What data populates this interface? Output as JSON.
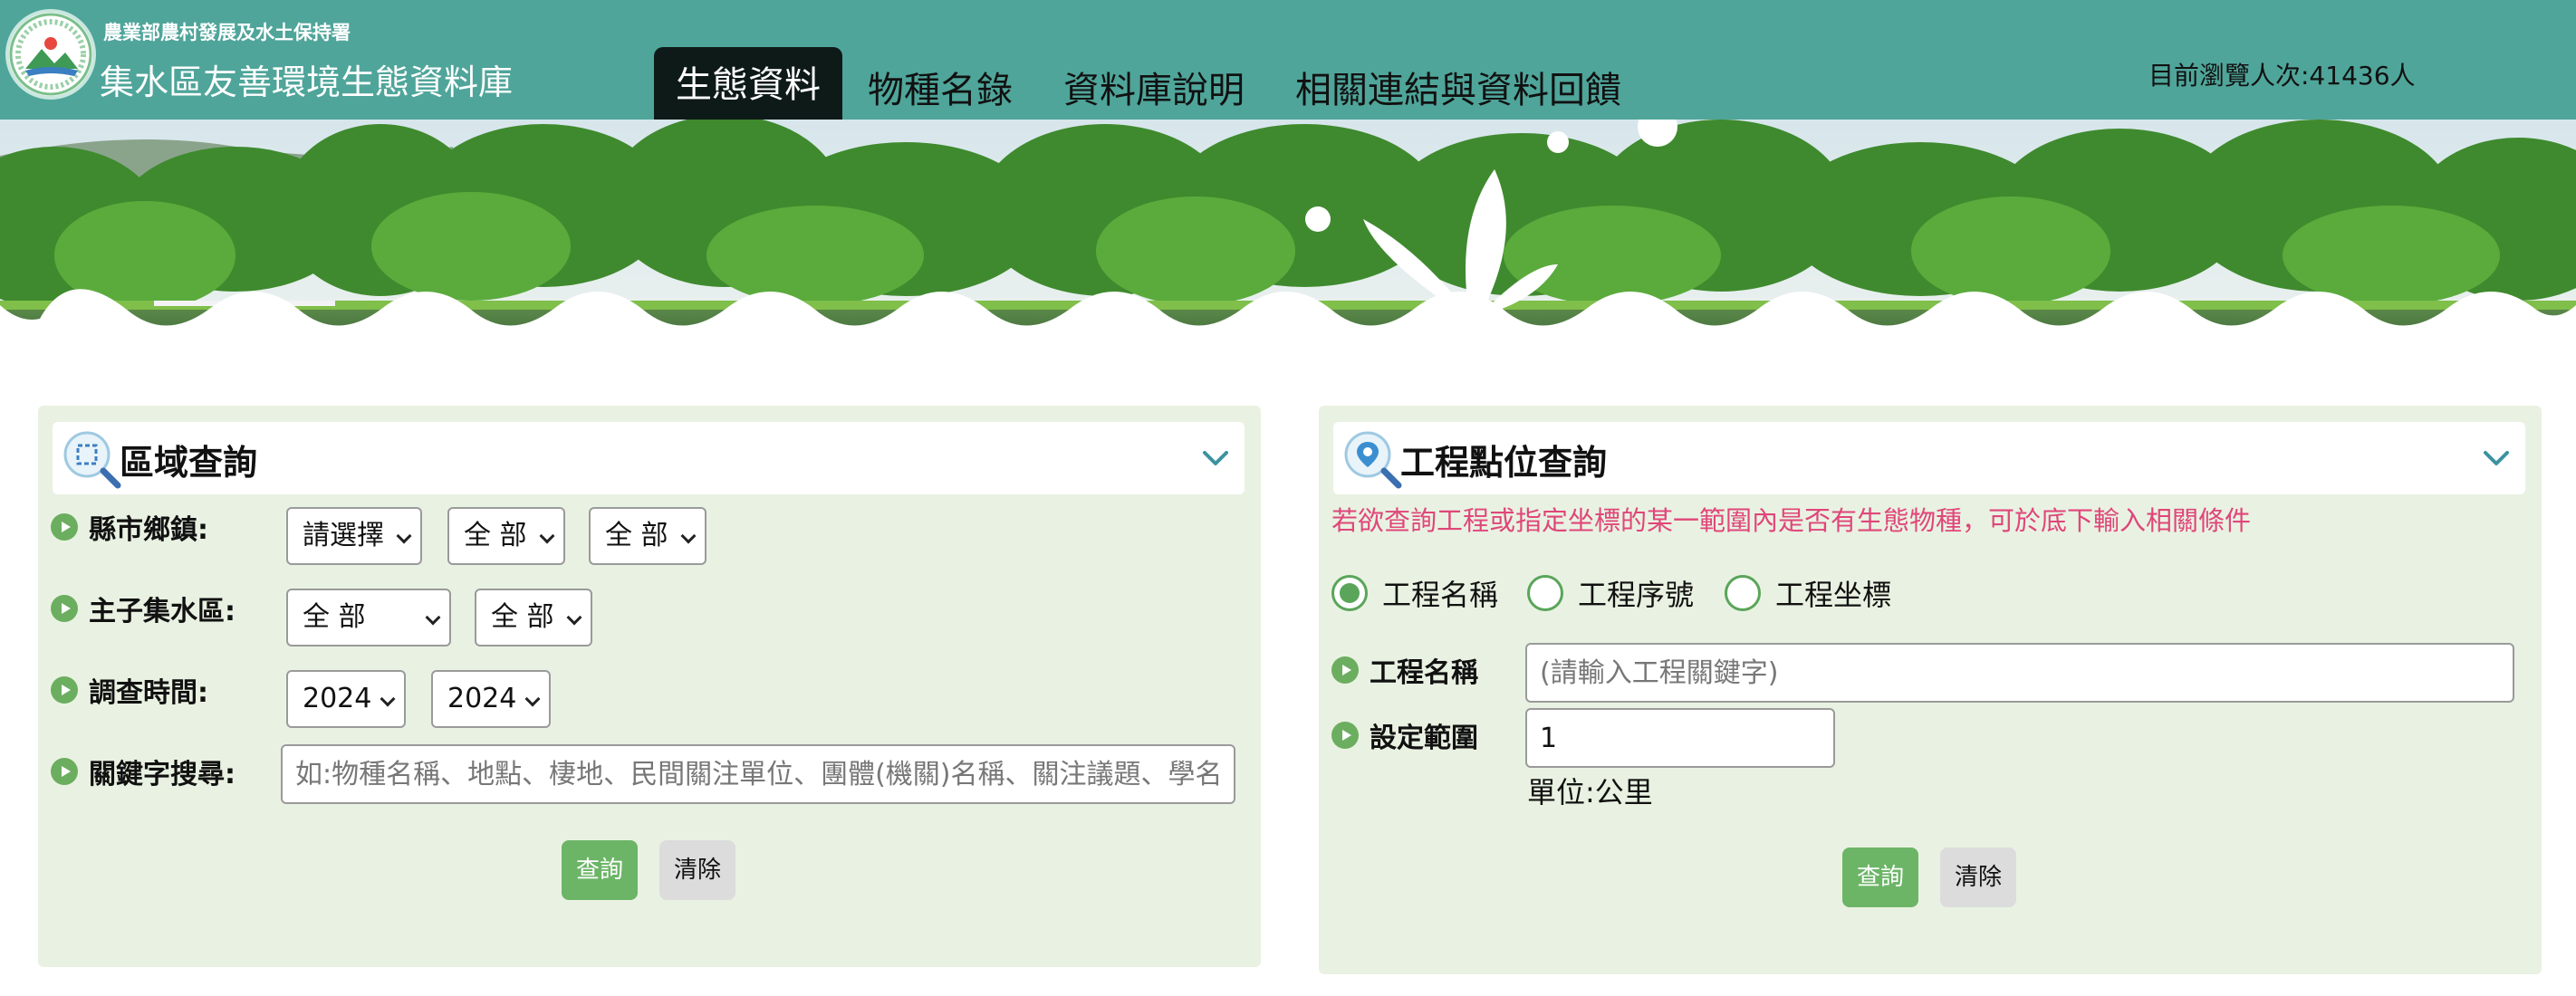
{
  "header": {
    "agency": "農業部農村發展及水土保持署",
    "site_name": "集水區友善環境生態資料庫",
    "nav": [
      {
        "label": "生態資料",
        "active": true
      },
      {
        "label": "物種名錄",
        "active": false
      },
      {
        "label": "資料庫說明",
        "active": false
      },
      {
        "label": "相關連結與資料回饋",
        "active": false
      }
    ],
    "visitors": "目前瀏覽人次:41436人"
  },
  "region_query": {
    "title": "區域查詢",
    "county_label": "縣市鄉鎮:",
    "county_select": "請選擇",
    "town_select": "全 部",
    "village_select": "全 部",
    "watershed_label": "主子集水區:",
    "main_watershed_select": "全 部",
    "sub_watershed_select": "全 部",
    "survey_time_label": "調查時間:",
    "year_from": "2024",
    "year_to": "2024",
    "keyword_label": "關鍵字搜尋:",
    "keyword_placeholder": "如:物種名稱、地點、棲地、民間關注單位、團體(機關)名稱、關注議題、學名",
    "query_button": "查詢",
    "clear_button": "清除"
  },
  "project_query": {
    "title": "工程點位查詢",
    "hint": "若欲查詢工程或指定坐標的某一範圍內是否有生態物種，可於底下輸入相關條件",
    "radio_options": [
      {
        "label": "工程名稱",
        "checked": true
      },
      {
        "label": "工程序號",
        "checked": false
      },
      {
        "label": "工程坐標",
        "checked": false
      }
    ],
    "project_name_label": "工程名稱",
    "project_name_placeholder": "(請輸入工程關鍵字)",
    "range_label": "設定範圍",
    "range_value": "1",
    "unit": "單位:公里",
    "query_button": "查詢",
    "clear_button": "清除"
  },
  "colors": {
    "header_bg": "#4fa59a",
    "nav_active_bg": "#0e1a18",
    "panel_bg": "#e9f2e2",
    "accent_green": "#6cb567",
    "hint_pink": "#e0467a"
  }
}
